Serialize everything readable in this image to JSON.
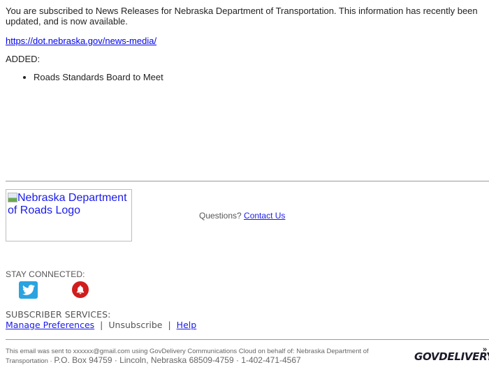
{
  "message": {
    "intro": "You are subscribed to News Releases for Nebraska Department of Transportation. This information has recently been updated, and is now available.",
    "link": "https://dot.nebraska.gov/news-media/",
    "added_label": "ADDED:",
    "items": [
      "Roads Standards Board to Meet"
    ]
  },
  "footer_top": {
    "logo_alt": "Nebraska Department of Roads Logo",
    "questions_label": "Questions?",
    "contact_link": "Contact Us"
  },
  "social": {
    "heading": "STAY CONNECTED:",
    "icons": [
      "twitter-icon",
      "bell-icon"
    ],
    "colors": {
      "twitter": "#2aa3e0",
      "alerts": "#d01d1d"
    }
  },
  "subscriber": {
    "heading": "SUBSCRIBER SERVICES:",
    "manage": "Manage Preferences",
    "separator": "|",
    "unsubscribe": "Unsubscribe",
    "help": "Help"
  },
  "legal": {
    "line1": "This email was sent to xxxxxx@gmail.com using GovDelivery Communications Cloud on behalf of: Nebraska Department of",
    "line2_small": "Transportation · ",
    "line2_big": "P.O. Box 94759 · Lincoln, Nebraska 68509-4759 · 1-402-471-4567",
    "brand": "GOVDELIVERY"
  }
}
